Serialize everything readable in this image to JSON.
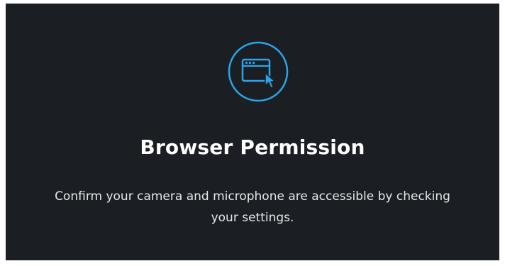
{
  "dialog": {
    "icon": "browser-window-cursor-icon",
    "title": "Browser Permission",
    "description": "Confirm your camera and microphone are accessible by checking your settings."
  },
  "colors": {
    "background": "#1b1f24",
    "accent": "#2aa5e8",
    "title": "#ffffff",
    "text": "#e6e8ea"
  }
}
